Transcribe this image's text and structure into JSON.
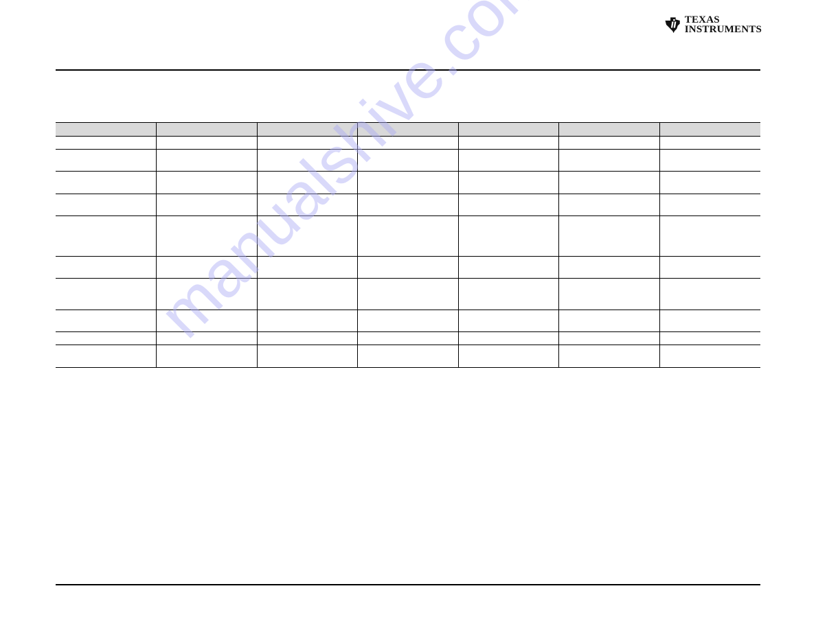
{
  "header": {
    "logo": {
      "icon": "ti-state-logo-icon",
      "line1": "Texas",
      "line2": "Instruments"
    }
  },
  "table": {
    "columns": [
      "",
      "",
      "",
      "",
      "",
      "",
      ""
    ],
    "rows": [
      [
        "",
        "",
        "",
        "",
        "",
        "",
        ""
      ],
      [
        "",
        "",
        "",
        "",
        "",
        "",
        ""
      ],
      [
        "",
        "",
        "",
        "",
        "",
        "",
        ""
      ],
      [
        "",
        "",
        "",
        "",
        "",
        "",
        ""
      ],
      [
        "",
        "",
        "",
        "",
        "",
        "",
        ""
      ],
      [
        "",
        "",
        "",
        "",
        "",
        "",
        ""
      ],
      [
        "",
        "",
        "",
        "",
        "",
        "",
        ""
      ],
      [
        "",
        "",
        "",
        "",
        "",
        "",
        ""
      ],
      [
        "",
        "",
        "",
        "",
        "",
        "",
        ""
      ],
      [
        "",
        "",
        "",
        "",
        "",
        "",
        ""
      ]
    ]
  },
  "watermark": {
    "text": "manualshive.com",
    "color": "#aaaaf5"
  }
}
